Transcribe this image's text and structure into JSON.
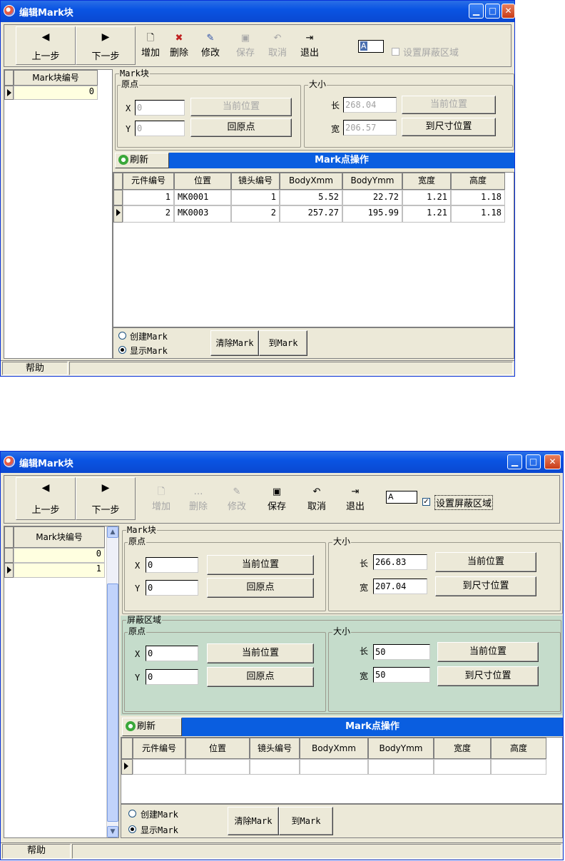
{
  "window1": {
    "title": "编辑Mark块",
    "toolbar": {
      "prev_label": "上一步",
      "next_label": "下一步",
      "add_label": "增加",
      "delete_label": "删除",
      "edit_label": "修改",
      "save_label": "保存",
      "cancel_label": "取消",
      "exit_label": "退出",
      "small_box_value": "A",
      "mask_checkbox_label": "设置屏蔽区域"
    },
    "left_grid": {
      "header": "Mark块编号",
      "rows": [
        "0"
      ]
    },
    "mark_block": {
      "legend": "Mark块",
      "origin_legend": "原点",
      "x_label": "X",
      "x_value": "0",
      "y_label": "Y",
      "y_value": "0",
      "current_pos_button": "当前位置",
      "back_origin_button": "回原点",
      "size_legend": "大小",
      "length_label": "长",
      "length_value": "268.04",
      "width_label": "宽",
      "width_value": "206.57",
      "size_current_pos_button": "当前位置",
      "to_size_pos_button": "到尺寸位置"
    },
    "refresh_label": "刷新",
    "mark_ops_title": "Mark点操作",
    "table": {
      "columns": [
        "元件编号",
        "位置",
        "镜头编号",
        "BodyXmm",
        "BodyYmm",
        "宽度",
        "高度"
      ],
      "rows": [
        [
          "1",
          "MK0001",
          "1",
          "5.52",
          "22.72",
          "1.21",
          "1.18"
        ],
        [
          "2",
          "MK0003",
          "2",
          "257.27",
          "195.99",
          "1.21",
          "1.18"
        ]
      ]
    },
    "radio_create": "创建Mark",
    "radio_show": "显示Mark",
    "clear_mark_button": "清除Mark",
    "to_mark_button": "到Mark",
    "help_label": "帮助"
  },
  "window2": {
    "title": "编辑Mark块",
    "toolbar": {
      "prev_label": "上一步",
      "next_label": "下一步",
      "add_label": "增加",
      "delete_label": "删除",
      "edit_label": "修改",
      "save_label": "保存",
      "cancel_label": "取消",
      "exit_label": "退出",
      "small_box_value": "A",
      "mask_checkbox_label": "设置屏蔽区域"
    },
    "left_grid": {
      "header": "Mark块编号",
      "rows": [
        "0",
        "1"
      ]
    },
    "mark_block": {
      "legend": "Mark块",
      "origin_legend": "原点",
      "x_label": "X",
      "x_value": "0",
      "y_label": "Y",
      "y_value": "0",
      "current_pos_button": "当前位置",
      "back_origin_button": "回原点",
      "size_legend": "大小",
      "length_label": "长",
      "length_value": "266.83",
      "width_label": "宽",
      "width_value": "207.04",
      "size_current_pos_button": "当前位置",
      "to_size_pos_button": "到尺寸位置"
    },
    "mask_block": {
      "legend": "屏蔽区域",
      "origin_legend": "原点",
      "x_label": "X",
      "x_value": "0",
      "y_label": "Y",
      "y_value": "0",
      "current_pos_button": "当前位置",
      "back_origin_button": "回原点",
      "size_legend": "大小",
      "length_label": "长",
      "length_value": "50",
      "width_label": "宽",
      "width_value": "50",
      "size_current_pos_button": "当前位置",
      "to_size_pos_button": "到尺寸位置"
    },
    "refresh_label": "刷新",
    "mark_ops_title": "Mark点操作",
    "table": {
      "columns": [
        "元件编号",
        "位置",
        "镜头编号",
        "BodyXmm",
        "BodyYmm",
        "宽度",
        "高度"
      ]
    },
    "radio_create": "创建Mark",
    "radio_show": "显示Mark",
    "clear_mark_button": "清除Mark",
    "to_mark_button": "到Mark",
    "help_label": "帮助"
  },
  "colors": {
    "title_blue": "#0a54e3",
    "header_blue": "#0a5ee0",
    "mask_green": "#c5dccb",
    "face": "#ece9d8"
  }
}
